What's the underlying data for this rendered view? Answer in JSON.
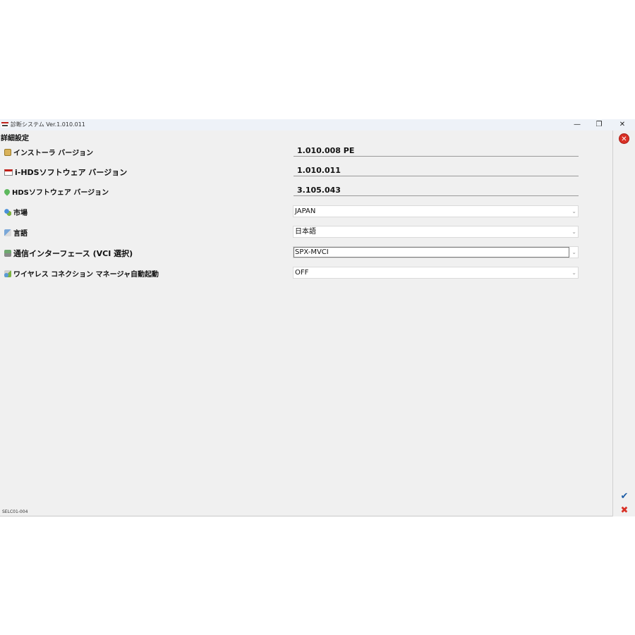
{
  "window": {
    "title": "診断システム Ver.1.010.011",
    "minimize": "—",
    "maximize": "❐",
    "close": "✕"
  },
  "section_title": "詳細設定",
  "rows": {
    "installer": {
      "label": "インストーラ バージョン",
      "value": "1.010.008 PE"
    },
    "ihds": {
      "label": "i-HDSソフトウェア バージョン",
      "value": "1.010.011"
    },
    "hds": {
      "label": "HDSソフトウェア バージョン",
      "value": "3.105.043"
    },
    "market": {
      "label": "市場",
      "value": "JAPAN"
    },
    "language": {
      "label": "言語",
      "value": "日本語"
    },
    "vci": {
      "label": "通信インターフェース (VCI 選択)",
      "value": "SPX-MVCI"
    },
    "wireless": {
      "label": "ワイヤレス コネクション マネージャ自動起動",
      "value": "OFF"
    }
  },
  "side": {
    "close": "✕",
    "ok": "✔",
    "cancel": "✖"
  },
  "chevron": "⌄",
  "footer_code": "SELC01-004"
}
